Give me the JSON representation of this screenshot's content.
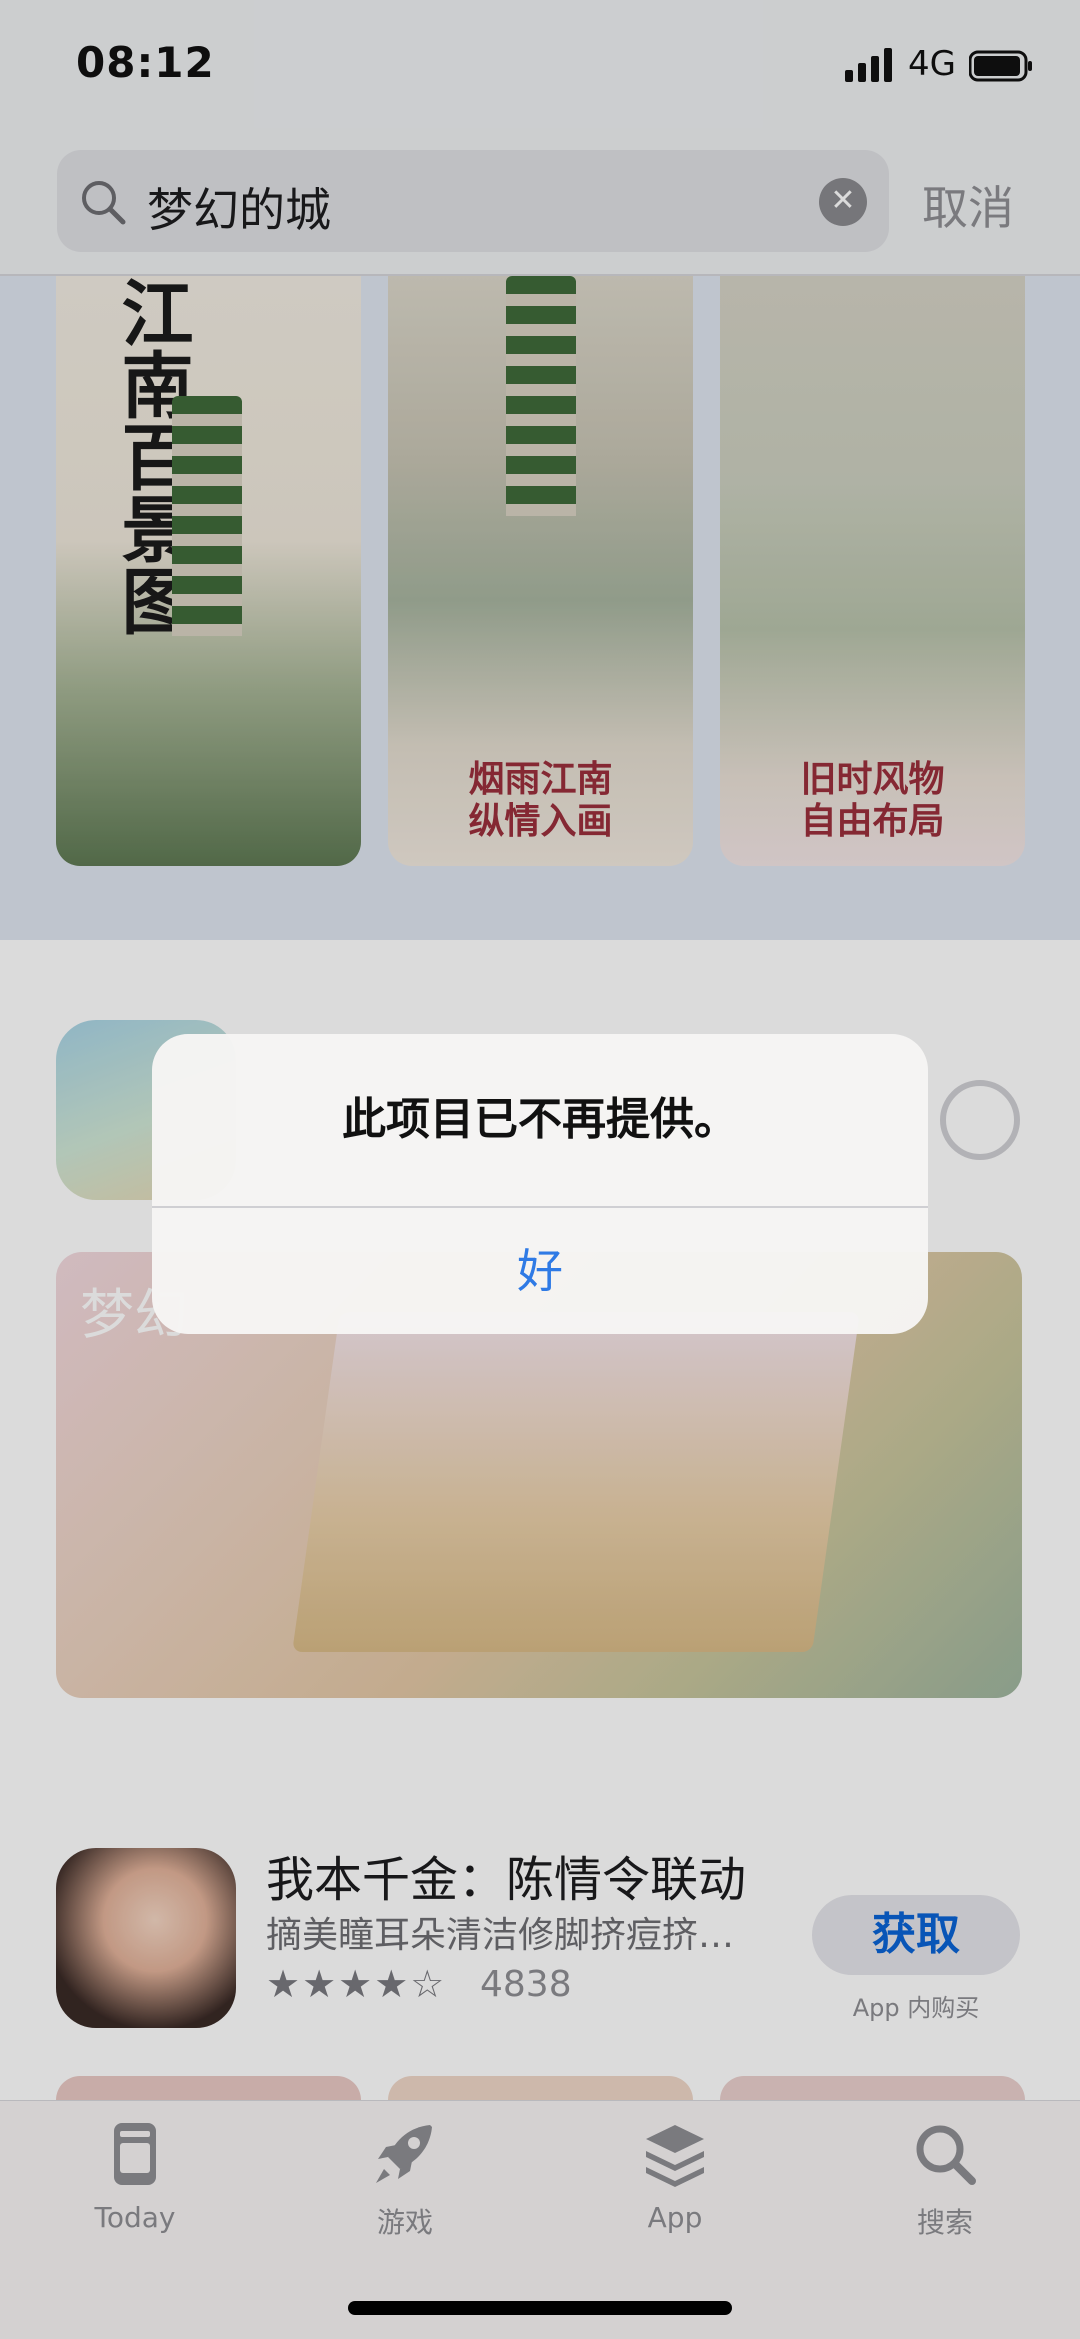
{
  "status_bar": {
    "time": "08:12",
    "network": "4G"
  },
  "search": {
    "query": "梦幻的城",
    "cancel_label": "取消"
  },
  "screenshots": [
    {
      "title": "江南百景图",
      "caption": ""
    },
    {
      "title": "",
      "caption": "烟雨江南\n纵情入画"
    },
    {
      "title": "",
      "caption": "旧时风物\n自由布局"
    }
  ],
  "banner": {
    "title": "梦幻"
  },
  "app": {
    "name": "我本千金：陈情令联动",
    "subtitle": "摘美瞳耳朵清洁修脚挤痘挤…",
    "stars": "★★★★☆",
    "rating_count": "4838",
    "get_label": "获取",
    "iap_label": "App 内购买"
  },
  "alert": {
    "message": "此项目已不再提供。",
    "ok_label": "好"
  },
  "tabbar": {
    "items": [
      {
        "label": "Today",
        "icon": "today-icon"
      },
      {
        "label": "游戏",
        "icon": "rocket-icon"
      },
      {
        "label": "App",
        "icon": "layers-icon"
      },
      {
        "label": "搜索",
        "icon": "search-icon"
      }
    ]
  },
  "colors": {
    "accent": "#2f7ae5",
    "get_button_text": "#0a64d6",
    "caption_red": "#9b2f3c"
  }
}
